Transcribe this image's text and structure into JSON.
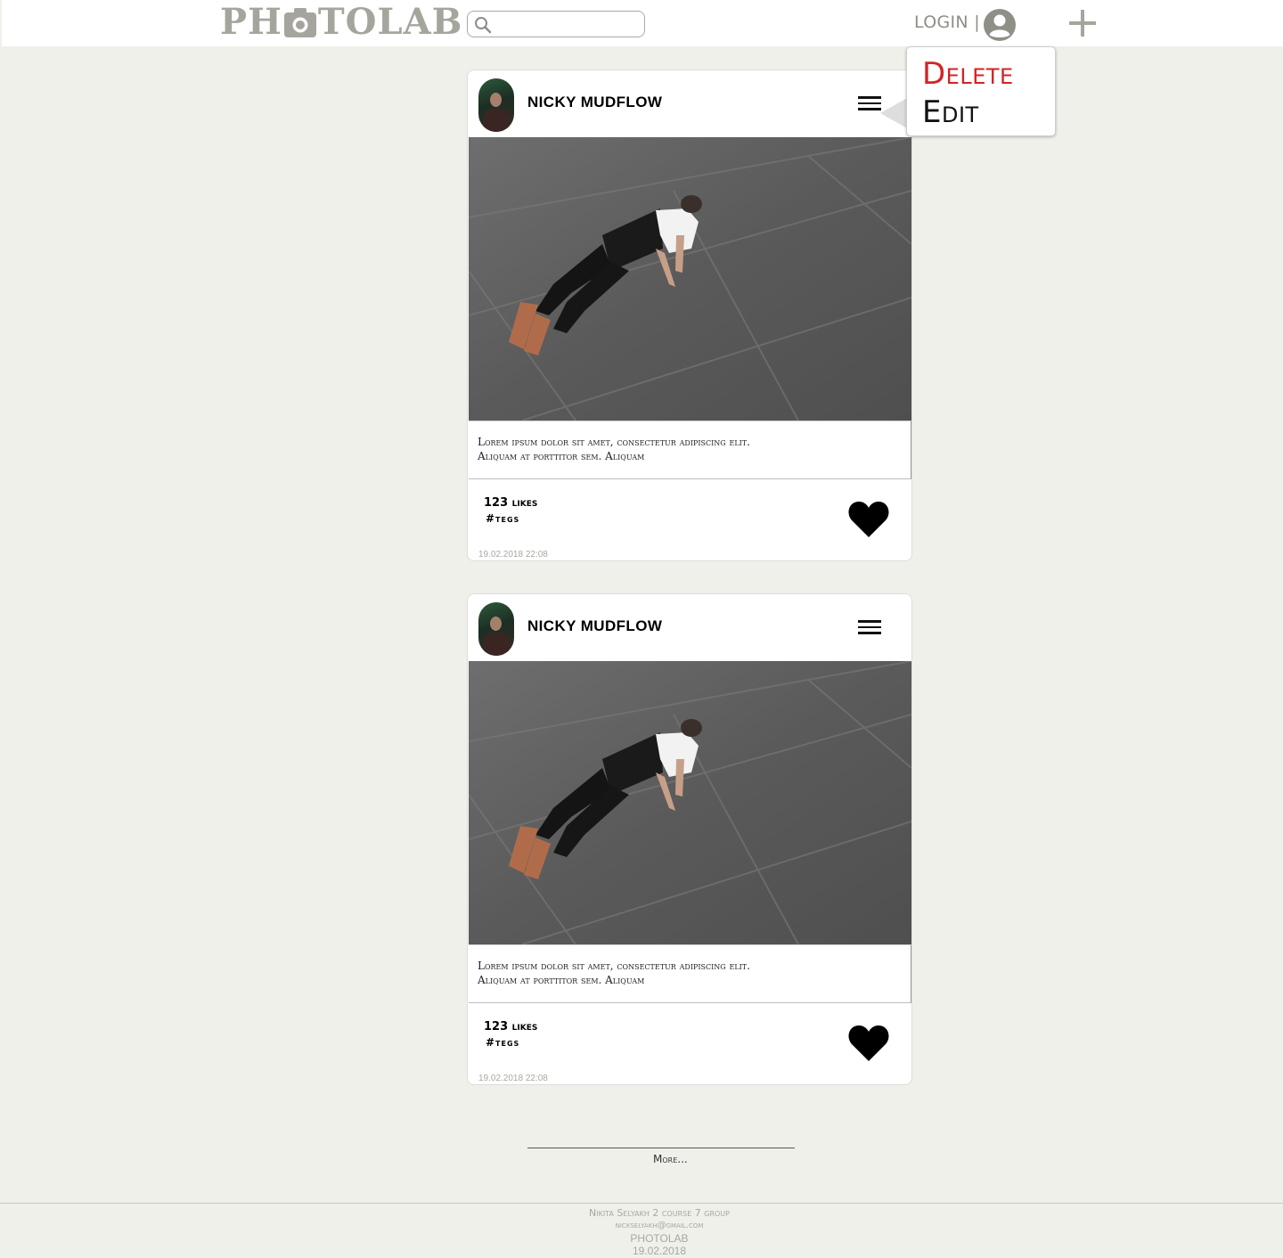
{
  "header": {
    "logo_left": "PH",
    "logo_right": "TOLAB",
    "search": {
      "placeholder": "",
      "value": ""
    },
    "login_label": "LOGIN |",
    "colors": {
      "logo": "#a5a59d",
      "login": "#8f8f87",
      "plus": "#a5a59d"
    }
  },
  "dropdown": {
    "items": [
      {
        "label": "Delete",
        "color": "#d32424"
      },
      {
        "label": "Edit",
        "color": "#111111"
      }
    ]
  },
  "posts": [
    {
      "author": "NICKY MUDFLOW",
      "caption": "Lorem ipsum dolor sit amet, consectetur adipiscing elit. Aliquam at porttitor sem.  Aliquam",
      "likes": "123 likes",
      "tags": "#tegs",
      "date": "19.02.2018 22:08"
    },
    {
      "author": "NICKY MUDFLOW",
      "caption": "Lorem ipsum dolor sit amet, consectetur adipiscing elit. Aliquam at porttitor sem.  Aliquam",
      "likes": "123 likes",
      "tags": "#tegs",
      "date": "19.02.2018 22:08"
    }
  ],
  "more_label": "More...",
  "footer": {
    "line1": "Nikita Selyakh 2 course 7 group",
    "line2": "nickselyakh@gmail.com",
    "line3": "PHOTOLAB",
    "line4": "19.02.2018"
  },
  "icons": [
    "camera-icon",
    "search-icon",
    "user-circle-icon",
    "plus-icon",
    "hamburger-menu-icon",
    "heart-icon"
  ]
}
